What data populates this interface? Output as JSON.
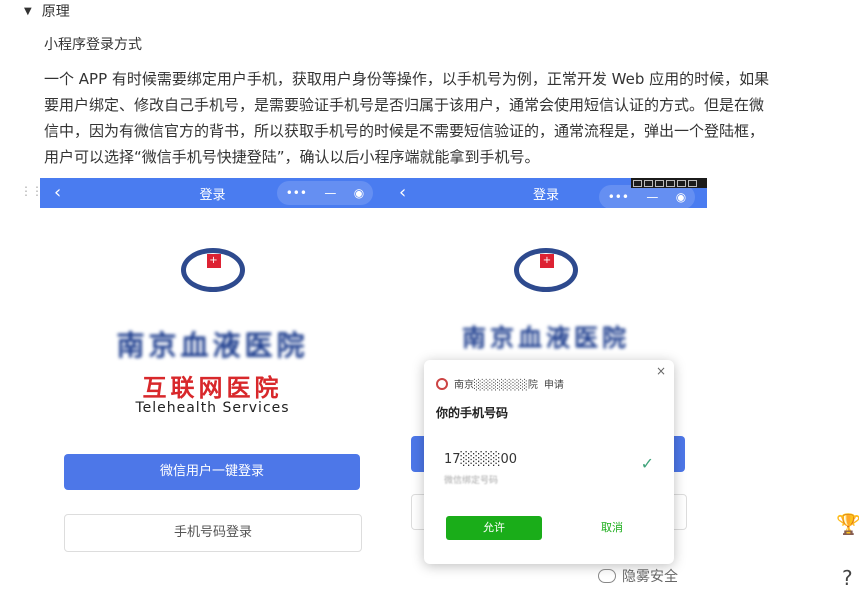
{
  "section": {
    "toggle_label": "原理",
    "subtitle": "小程序登录方式"
  },
  "paragraph": "一个 APP 有时候需要绑定用户手机，获取用户身份等操作，以手机号为例，正常开发 Web 应用的时候，如果要用户绑定、修改自己手机号，是需要验证手机号是否归属于该用户，通常会使用短信认证的方式。但是在微信中，因为有微信官方的背书，所以获取手机号的时候是不需要短信验证的，通常流程是，弹出一个登陆框，用户可以选择“微信手机号快捷登陆”，确认以后小程序端就能拿到手机号。",
  "left_phone": {
    "nav_back": "‹",
    "nav_title": "登录",
    "capsule": {
      "more": "•••",
      "minimize": "—",
      "close": "◉"
    },
    "hospital_name": "南京血液医院",
    "brand_cn": "互联网医院",
    "brand_en": "Telehealth Services",
    "wechat_login_button": "微信用户一键登录",
    "phone_login_button": "手机号码登录"
  },
  "right_phone": {
    "nav_back": "‹",
    "nav_title": "登录",
    "capsule": {
      "more": "•••",
      "minimize": "—",
      "close": "◉"
    },
    "hospital_name": "南京血液医院"
  },
  "dialog": {
    "close": "×",
    "app_name": "南京░░░░░░░院",
    "request": "申请",
    "title": "你的手机号码",
    "phone_number": "17░░░░00",
    "hint": "微信绑定号码",
    "allow_button": "允许",
    "cancel_button": "取消"
  },
  "watermark": "隐雾安全",
  "icons": {
    "trophy": "🏆",
    "help": "?"
  },
  "colors": {
    "accent": "#4a7cf0",
    "wechat_green": "#1aad19",
    "brand_red": "#d8282b"
  }
}
